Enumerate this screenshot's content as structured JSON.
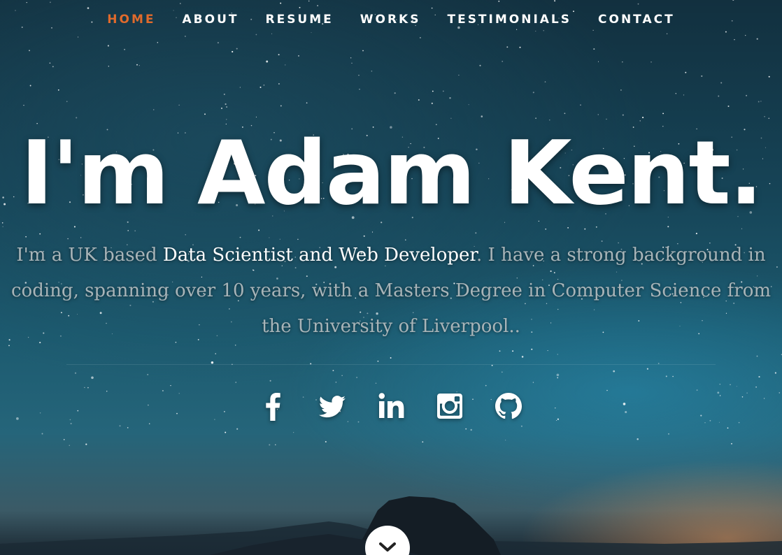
{
  "nav": {
    "items": [
      {
        "label": "HOME",
        "active": true
      },
      {
        "label": "ABOUT",
        "active": false
      },
      {
        "label": "RESUME",
        "active": false
      },
      {
        "label": "WORKS",
        "active": false
      },
      {
        "label": "TESTIMONIALS",
        "active": false
      },
      {
        "label": "CONTACT",
        "active": false
      }
    ],
    "active_color": "#e06a2c"
  },
  "hero": {
    "title": "I'm Adam Kent.",
    "intro_prefix": "I'm a UK based ",
    "intro_highlight": "Data Scientist and Web Developer",
    "intro_suffix": ". I have a strong background in coding, spanning over 10 years, with a Masters Degree in Computer Science from the University of Liverpool.."
  },
  "social": [
    {
      "icon": "facebook-icon"
    },
    {
      "icon": "twitter-icon"
    },
    {
      "icon": "linkedin-icon"
    },
    {
      "icon": "instagram-icon"
    },
    {
      "icon": "github-icon"
    }
  ],
  "scroll_down": {
    "icon": "chevron-down-icon"
  }
}
